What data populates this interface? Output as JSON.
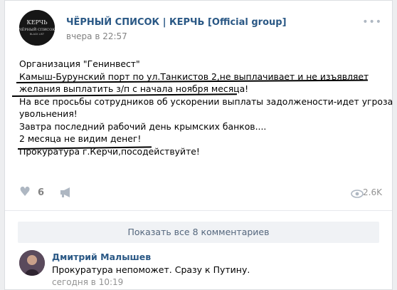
{
  "post": {
    "group_name": "ЧЁРНЫЙ СПИСОК | КЕРЧЬ [Official group]",
    "time": "вчера в 22:57",
    "avatar_text_top": "КЕРЧЬ",
    "avatar_text_mid": "ЧЁРНЫЙ СПИСОК",
    "avatar_text_small": "BLACK LIST",
    "lines": [
      "Организация \"Генинвест\"",
      "Камыш-Бурунский порт по ул.Танкистов 2,не выплачивает и не изъявляет",
      "желания выплатить з/п с начала ноября месяца!",
      "На все просьбы сотрудников об ускорении выплаты задолжености-идет угроза",
      "увольнения!",
      "Завтра последний рабочий день крымских банков....",
      "2 месяца не видим денег!",
      "Прокуратура г.Керчи,посодействуйте!"
    ],
    "likes": "6",
    "views": "2.6K"
  },
  "comments": {
    "show_all_label": "Показать все 8 комментариев",
    "items": [
      {
        "author": "Дмитрий Малышев",
        "text": "Прокуратура непоможет. Сразу к Путину.",
        "time": "сегодня в 10:19"
      }
    ]
  },
  "icons": {
    "like": "heart-icon",
    "share": "megaphone-icon",
    "views": "eye-icon",
    "menu": "more-dots-icon"
  },
  "colors": {
    "link": "#2a5885",
    "muted": "#828282",
    "icon": "#aeb7c2"
  }
}
